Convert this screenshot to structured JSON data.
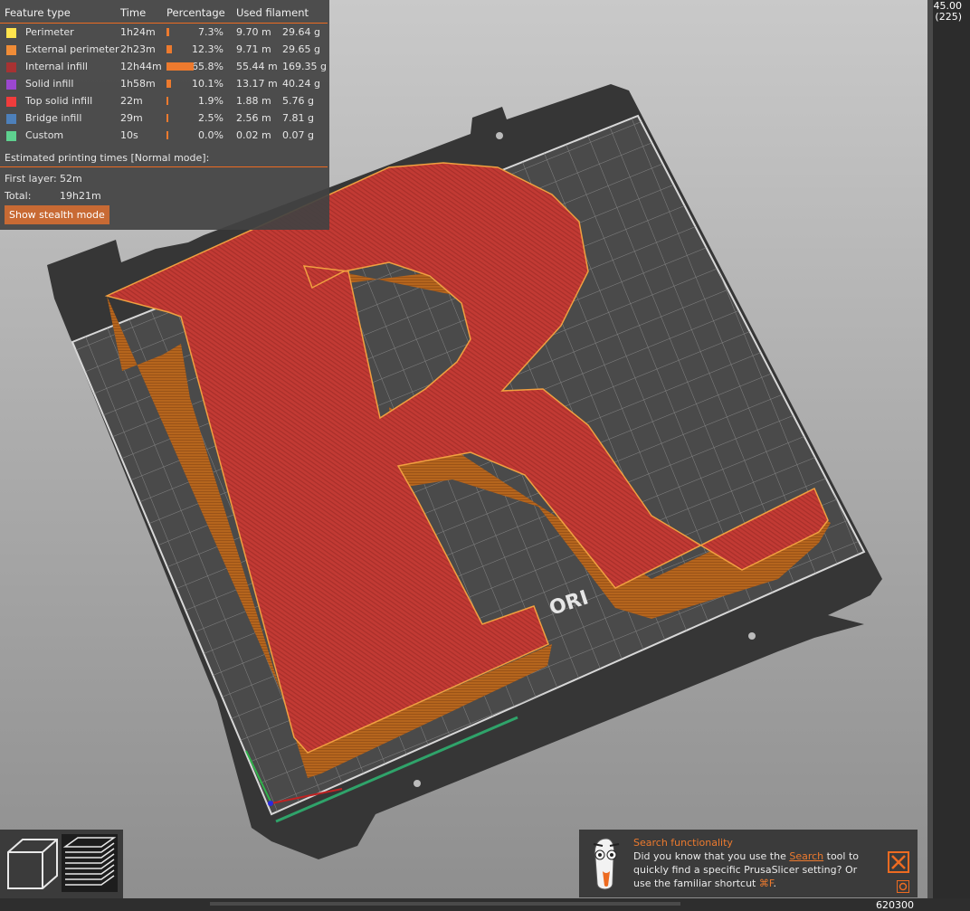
{
  "legend": {
    "headers": {
      "feature_type": "Feature type",
      "time": "Time",
      "percentage": "Percentage",
      "used_filament": "Used filament"
    },
    "rows": [
      {
        "name": "Perimeter",
        "color": "#ffe44d",
        "time": "1h24m",
        "percent": "7.3%",
        "length": "9.70 m",
        "weight": "29.64 g",
        "fraction": 7.3
      },
      {
        "name": "External perimeter",
        "color": "#f08c37",
        "time": "2h23m",
        "percent": "12.3%",
        "length": "9.71 m",
        "weight": "29.65 g",
        "fraction": 12.3
      },
      {
        "name": "Internal infill",
        "color": "#a83232",
        "time": "12h44m",
        "percent": "65.8%",
        "length": "55.44 m",
        "weight": "169.35 g",
        "fraction": 65.8
      },
      {
        "name": "Solid infill",
        "color": "#9b47cf",
        "time": "1h58m",
        "percent": "10.1%",
        "length": "13.17 m",
        "weight": "40.24 g",
        "fraction": 10.1
      },
      {
        "name": "Top solid infill",
        "color": "#f03c3c",
        "time": "22m",
        "percent": "1.9%",
        "length": "1.88 m",
        "weight": "5.76 g",
        "fraction": 1.9
      },
      {
        "name": "Bridge infill",
        "color": "#4d80ba",
        "time": "29m",
        "percent": "2.5%",
        "length": "2.56 m",
        "weight": "7.81 g",
        "fraction": 2.5
      },
      {
        "name": "Custom",
        "color": "#5ed18f",
        "time": "10s",
        "percent": "0.0%",
        "length": "0.02 m",
        "weight": "0.07 g",
        "fraction": 0.0
      }
    ],
    "estimated_label": "Estimated printing times [Normal mode]:",
    "first_layer_label": "First layer:",
    "first_layer_value": "52m",
    "total_label": "Total:",
    "total_value": "19h21m",
    "stealth_button": "Show stealth mode"
  },
  "plate_text": "ORI",
  "vertical_slider": {
    "max_value": "45.00",
    "max_layer": "(225)"
  },
  "horizontal_slider": {
    "value": "620300"
  },
  "hint": {
    "title": "Search functionality",
    "text_before": "Did you know that you use the ",
    "link": "Search",
    "text_after": " tool to quickly find a specific PrusaSlicer setting? Or use the familiar shortcut ",
    "shortcut": "⌘F",
    "text_end": "."
  },
  "colors": {
    "accent": "#ed6b21",
    "model_top": "#c23a34",
    "model_side": "#b5651d",
    "bed": "#3a3a3a"
  }
}
